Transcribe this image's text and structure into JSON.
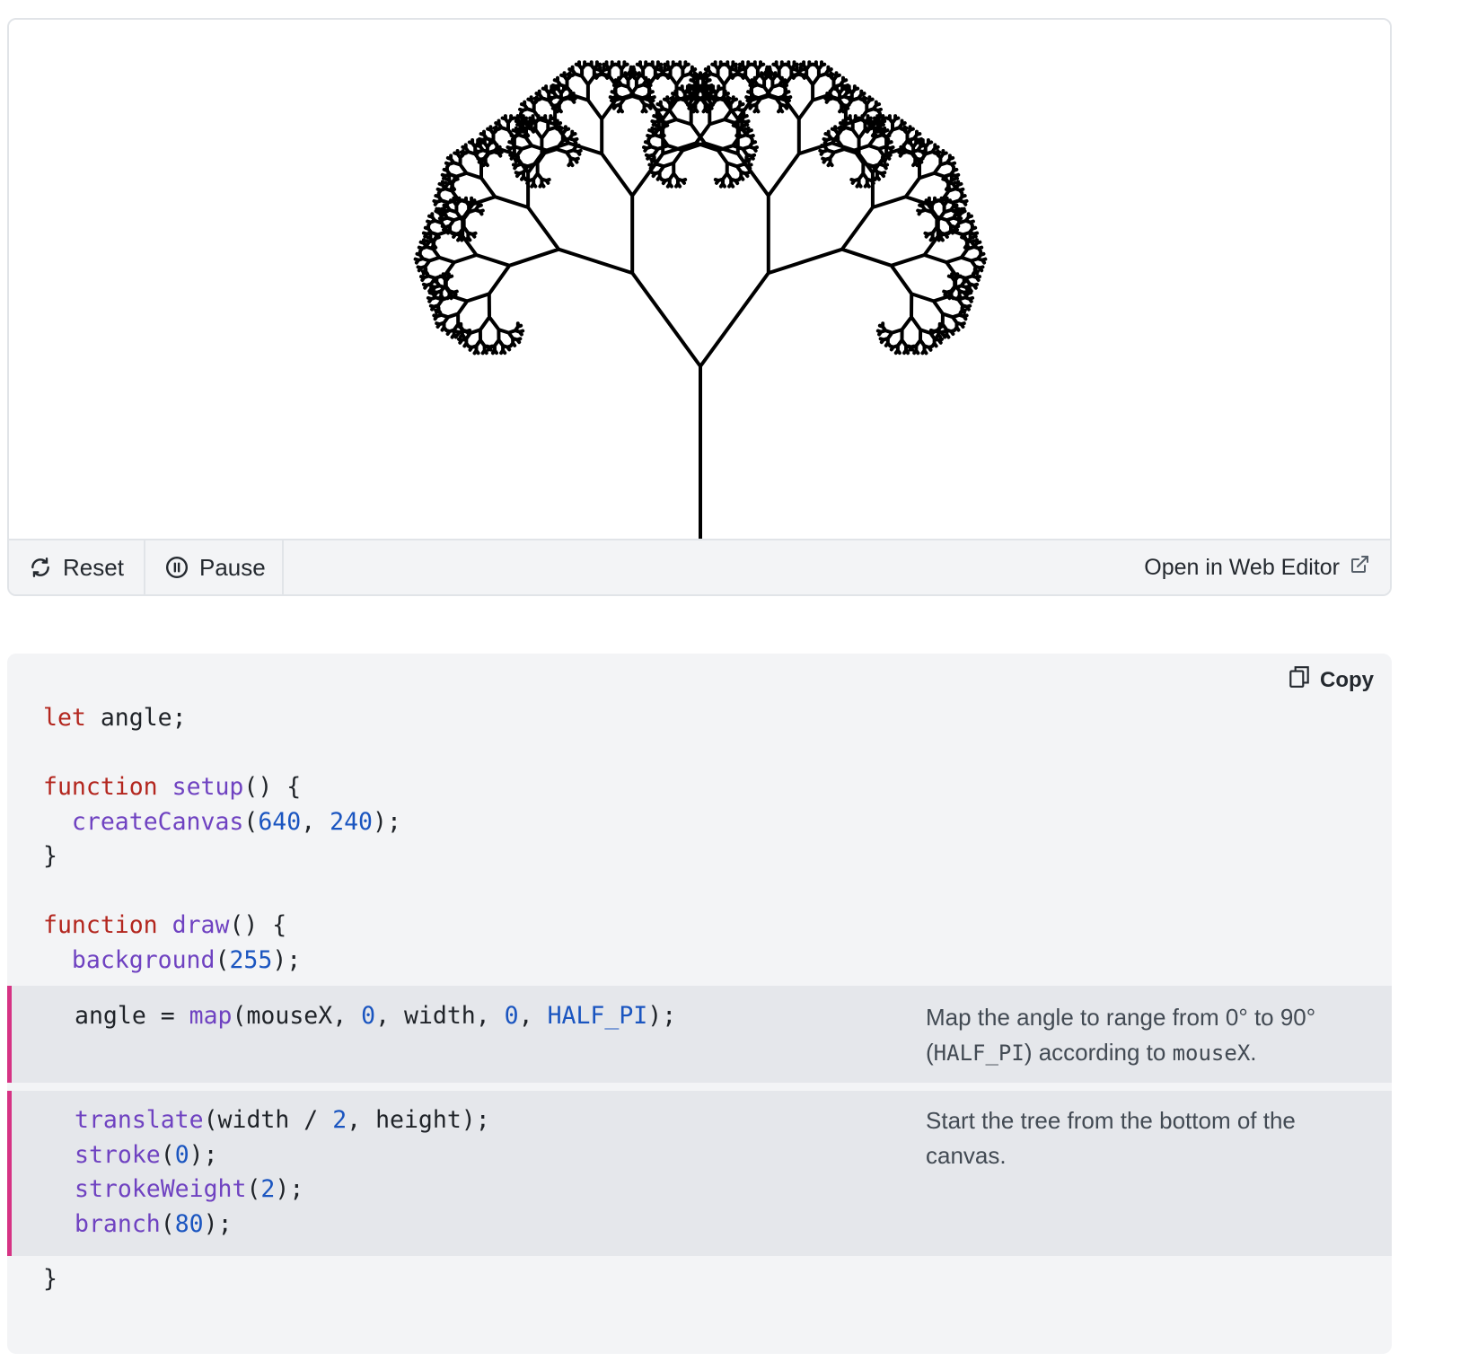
{
  "controls": {
    "reset_label": "Reset",
    "pause_label": "Pause",
    "open_editor_label": "Open in Web Editor"
  },
  "code": {
    "copy_label": "Copy",
    "l1": {
      "kw": "let",
      "rest": " angle;"
    },
    "l2": {
      "kw": "function",
      "fn": "setup",
      "rest": "() {"
    },
    "l3": {
      "fn": "createCanvas",
      "p1": "(",
      "n1": "640",
      "c": ", ",
      "n2": "240",
      "end": ");"
    },
    "l4": "}",
    "l5": {
      "kw": "function",
      "fn": "draw",
      "rest": "() {"
    },
    "l6": {
      "fn": "background",
      "p1": "(",
      "n1": "255",
      "end": ");"
    },
    "l7": {
      "pre": "angle = ",
      "fn": "map",
      "a": "(mouseX, ",
      "n1": "0",
      "b": ", width, ",
      "n2": "0",
      "c": ", ",
      "n3": "HALF_PI",
      "end": ");"
    },
    "l8": {
      "fn": "translate",
      "a": "(width / ",
      "n1": "2",
      "end": ", height);"
    },
    "l9": {
      "fn": "stroke",
      "p1": "(",
      "n1": "0",
      "end": ");"
    },
    "l10": {
      "fn": "strokeWeight",
      "p1": "(",
      "n1": "2",
      "end": ");"
    },
    "l11": {
      "fn": "branch",
      "p1": "(",
      "n1": "80",
      "end": ");"
    },
    "l12": "}",
    "note1": {
      "a": "Map the angle to range from 0° to 90° (",
      "code1": "HALF_PI",
      "b": ") according to ",
      "code2": "mouseX",
      "c": "."
    },
    "note2": "Start the tree from the bottom of the canvas."
  }
}
